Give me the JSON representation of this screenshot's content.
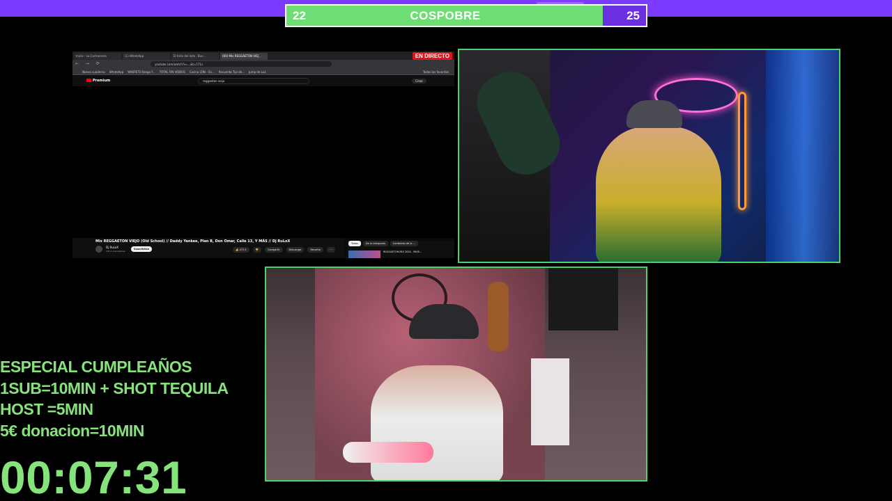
{
  "poll": {
    "left_value": "22",
    "title": "COSPOBRE",
    "right_value": "25",
    "left_fraction": 0.88
  },
  "browser": {
    "live_badge": "EN DIRECTO",
    "tabs": [
      "Inicio - La Cacharrería",
      "(1) WhatsApp",
      "El tirón del listo · Bus...",
      "(60) Mix REGGAETON VIEJ..."
    ],
    "address": "youtube.com/watch?v=...&t=171s",
    "bookmarks": [
      "Nuevo cuaderno",
      "WhatsApp",
      "WIKIPETS Rango F...",
      "TOTAL FIN VIDEOS",
      "Cocina (29k · Es...",
      "Recuerda Tipi de...",
      "Jump de Luz",
      "Todos los favoritos"
    ],
    "youtube": {
      "logo": "Premium",
      "search_value": "reggaeton viejo",
      "create_label": "Crear",
      "video_title": "Mix REGGAETON VIEJO (Old School) // Daddy Yankee, Plan B, Don Omar, Calle 13, Y MÁS // Dj RuLoX",
      "channel": "Dj RuLoX",
      "subscribers": "141 k suscriptores",
      "subscribe_label": "Suscribirse",
      "actions": [
        "👍 472 K",
        "👎",
        "Compartir",
        "Descargar",
        "Recortar",
        "···"
      ],
      "chips": [
        "Todos",
        "De tu búsqueda",
        "Contenido de la ..."
      ],
      "rec_title": "REGGAETON MIX 2024 - MIXE..."
    }
  },
  "overlay": {
    "promo_lines": [
      "ESPECIAL CUMPLEAÑOS",
      "1SUB=10MIN + SHOT TEQUILA",
      "HOST =5MIN",
      "5€ donacion=10MIN"
    ],
    "timer": "00:07:31"
  },
  "colors": {
    "top_bar": "#7b3cff",
    "poll_green": "#6fdd75",
    "poll_purple": "#6a2fe0",
    "cam_border": "#4fd16e",
    "overlay_text": "#86e27a"
  }
}
